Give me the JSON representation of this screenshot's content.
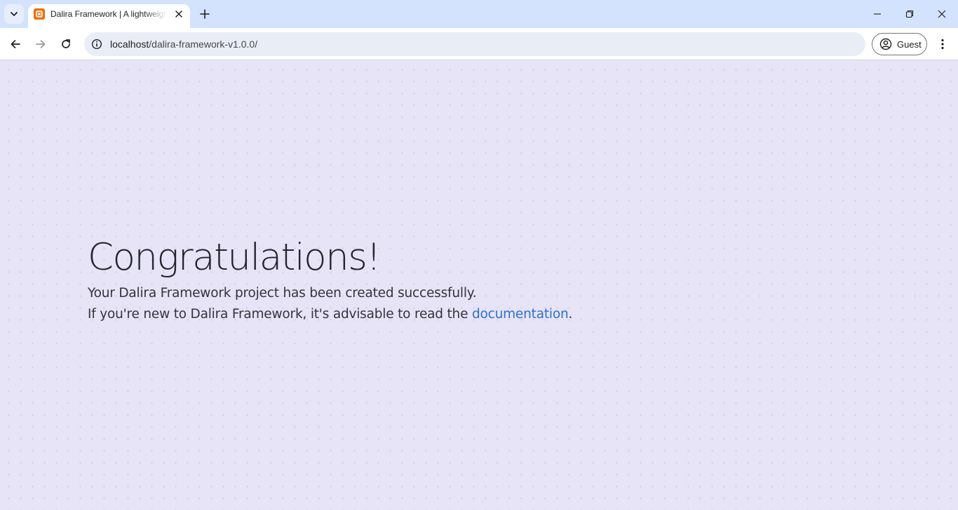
{
  "browser": {
    "tab": {
      "title": "Dalira Framework | A lightweight PHP framework",
      "favicon": "dalira-favicon-icon"
    },
    "url": {
      "host": "localhost",
      "path": "/dalira-framework-v1.0.0/"
    },
    "profile_label": "Guest"
  },
  "page": {
    "headline": "Congratulations!",
    "line1": "Your Dalira Framework project has been created successfully.",
    "line2_prefix": "If you're new to Dalira Framework, it's advisable to read the ",
    "link_text": "documentation",
    "line2_suffix": "."
  },
  "colors": {
    "accent_link": "#2f6fd1",
    "page_background": "#e6e4f6",
    "tabstrip_background": "#d3e3fd",
    "favicon": "#e8710a"
  },
  "icons": [
    "tab-search-icon",
    "close-icon",
    "plus-icon",
    "minimize-icon",
    "restore-icon",
    "back-arrow-icon",
    "forward-arrow-icon",
    "reload-icon",
    "info-icon",
    "profile-icon",
    "kebab-menu-icon"
  ]
}
